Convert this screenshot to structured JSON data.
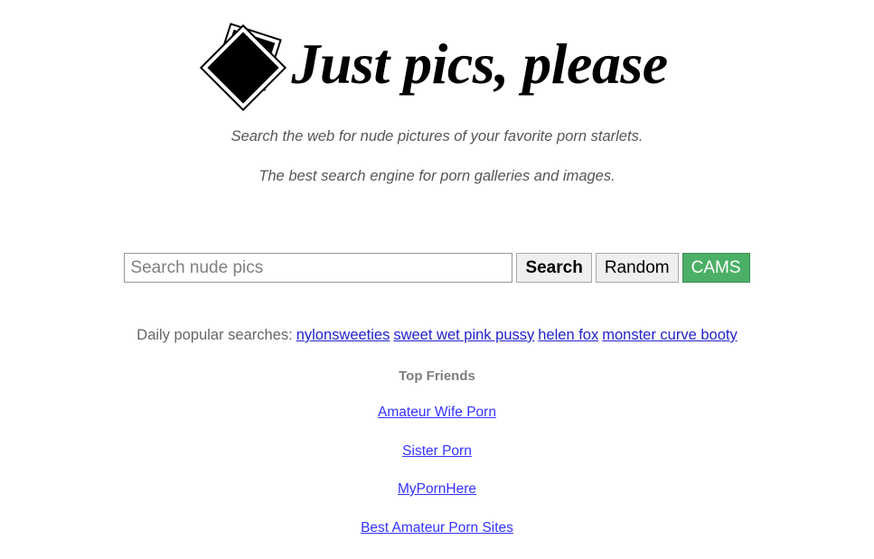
{
  "header": {
    "title": "Just pics, please",
    "logo_icon": "stacked-photos-icon"
  },
  "taglines": {
    "line1": "Search the web for nude pictures of your favorite porn starlets.",
    "line2": "The best search engine for porn galleries and images."
  },
  "search": {
    "placeholder": "Search nude pics",
    "value": "",
    "search_label": "Search",
    "random_label": "Random",
    "cams_label": "CAMS",
    "cams_color": "#4caf67"
  },
  "popular": {
    "label": "Daily popular searches:",
    "links": [
      "nylonsweeties",
      "sweet wet pink pussy",
      "helen fox",
      "monster curve booty"
    ],
    "link_color": "#2222cc"
  },
  "friends": {
    "title": "Top Friends",
    "links": [
      "Amateur Wife Porn",
      "Sister Porn",
      "MyPornHere",
      "Best Amateur Porn Sites"
    ],
    "link_color": "#3333ff"
  }
}
